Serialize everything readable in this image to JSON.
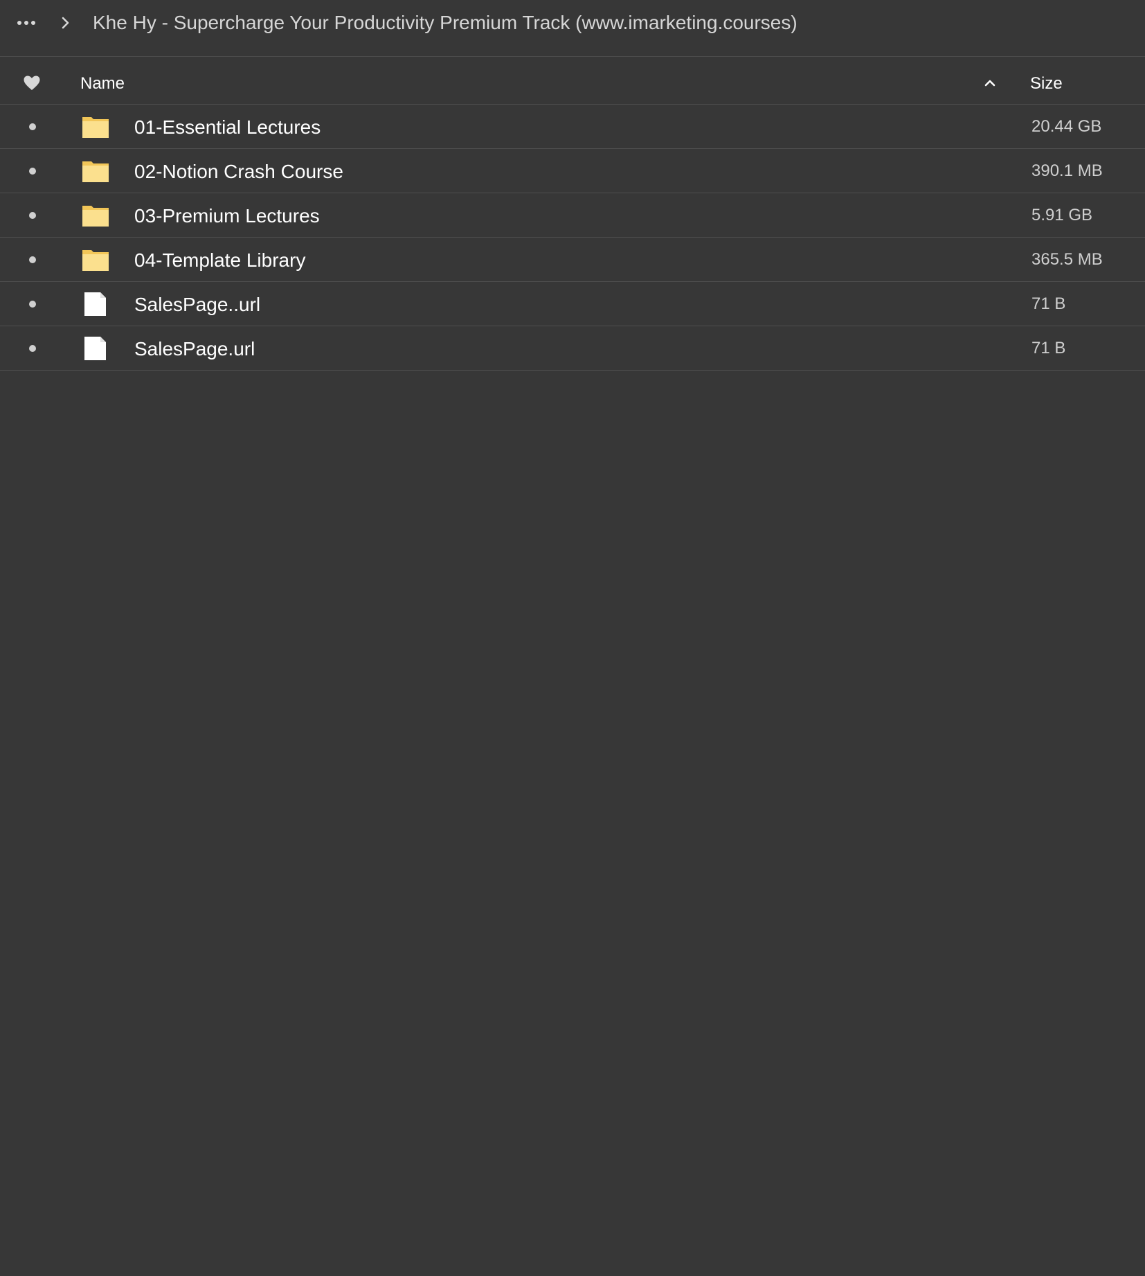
{
  "breadcrumb": {
    "more_icon": "ellipsis-icon",
    "separator_icon": "chevron-right-icon",
    "title": "Khe Hy - Supercharge Your Productivity Premium Track (www.imarketing.courses)"
  },
  "table": {
    "favorite_icon": "heart-icon",
    "name_header": "Name",
    "sort_icon": "chevron-up-icon",
    "size_header": "Size",
    "rows": [
      {
        "type": "folder",
        "name": "01-Essential Lectures",
        "size": "20.44 GB"
      },
      {
        "type": "folder",
        "name": "02-Notion Crash Course",
        "size": "390.1 MB"
      },
      {
        "type": "folder",
        "name": "03-Premium Lectures",
        "size": "5.91 GB"
      },
      {
        "type": "folder",
        "name": "04-Template Library",
        "size": "365.5 MB"
      },
      {
        "type": "file",
        "name": "SalesPage..url",
        "size": "71 B"
      },
      {
        "type": "file",
        "name": "SalesPage.url",
        "size": "71 B"
      }
    ]
  },
  "colors": {
    "background": "#373737",
    "folder": "#f8d775",
    "divider": "#4e4e4e"
  }
}
